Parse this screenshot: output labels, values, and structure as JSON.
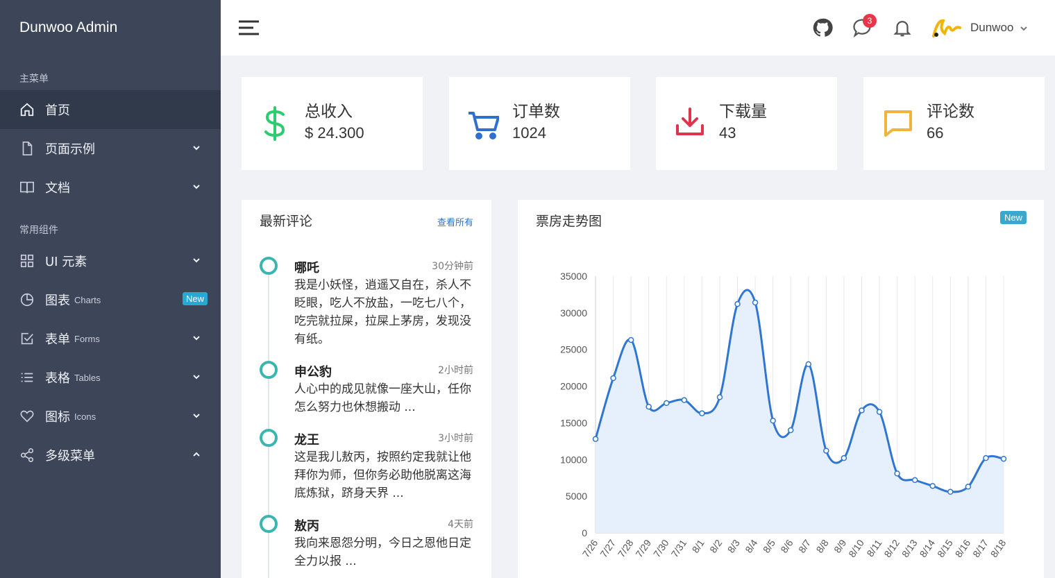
{
  "brand": "Dunwoo Admin",
  "sidebar": {
    "group_main": "主菜单",
    "group_common": "常用组件",
    "items": [
      {
        "label": "首页",
        "sub": ""
      },
      {
        "label": "页面示例",
        "sub": ""
      },
      {
        "label": "文档",
        "sub": ""
      },
      {
        "label": "UI 元素",
        "sub": ""
      },
      {
        "label": "图表",
        "sub": "Charts",
        "badge": "New"
      },
      {
        "label": "表单",
        "sub": "Forms"
      },
      {
        "label": "表格",
        "sub": "Tables"
      },
      {
        "label": "图标",
        "sub": "Icons"
      },
      {
        "label": "多级菜单",
        "sub": ""
      }
    ]
  },
  "header": {
    "message_count": "3",
    "username": "Dunwoo"
  },
  "stats": [
    {
      "label": "总收入",
      "value": "$ 24.300",
      "color": "#2ecc71"
    },
    {
      "label": "订单数",
      "value": "1024",
      "color": "#2f6fd0"
    },
    {
      "label": "下载量",
      "value": "43",
      "color": "#e0344e"
    },
    {
      "label": "评论数",
      "value": "66",
      "color": "#f1b43a"
    }
  ],
  "comments": {
    "title": "最新评论",
    "view_all": "查看所有",
    "items": [
      {
        "name": "哪吒",
        "time": "30分钟前",
        "text": "我是小妖怪，逍遥又自在，杀人不眨眼，吃人不放盐，一吃七八个，吃完就拉屎，拉屎上茅房，发现没有纸。"
      },
      {
        "name": "申公豹",
        "time": "2小时前",
        "text": "人心中的成见就像一座大山，任你怎么努力也休想搬动 ..."
      },
      {
        "name": "龙王",
        "time": "3小时前",
        "text": "这是我儿敖丙，按照约定我就让他拜你为师，但你务必助他脱离这海底炼狱，跻身天界 ..."
      },
      {
        "name": "敖丙",
        "time": "4天前",
        "text": "我向来恩怨分明，今日之恩他日定全力以报 ..."
      }
    ]
  },
  "chart_card": {
    "title": "票房走势图",
    "badge": "New"
  },
  "chart_data": {
    "type": "area",
    "title": "票房走势图",
    "categories": [
      "7/26",
      "7/27",
      "7/28",
      "7/29",
      "7/30",
      "7/31",
      "8/1",
      "8/2",
      "8/3",
      "8/4",
      "8/5",
      "8/6",
      "8/7",
      "8/8",
      "8/9",
      "8/10",
      "8/11",
      "8/12",
      "8/13",
      "8/14",
      "8/15",
      "8/16",
      "8/17",
      "8/18"
    ],
    "values": [
      12800,
      21100,
      26300,
      17200,
      17700,
      18100,
      16300,
      18500,
      31200,
      31400,
      15300,
      14000,
      23000,
      11200,
      10200,
      16700,
      16500,
      8100,
      7200,
      6400,
      5600,
      6300,
      10200,
      10100
    ],
    "ylim": [
      0,
      35000
    ],
    "yticks": [
      0,
      5000,
      10000,
      15000,
      20000,
      25000,
      30000,
      35000
    ],
    "grid": true,
    "line_color": "#2f76d2",
    "fill_color": "#e6effc"
  }
}
